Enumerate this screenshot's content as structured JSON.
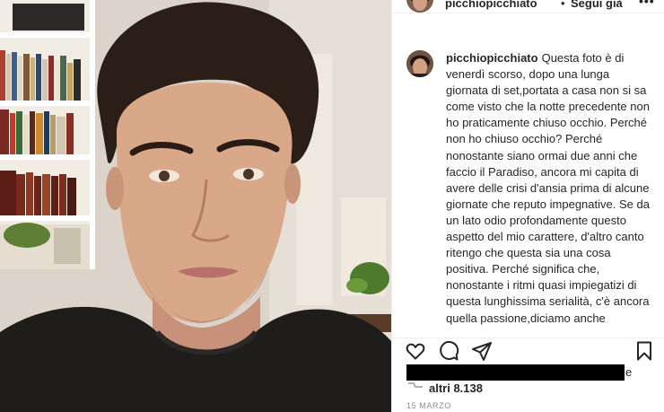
{
  "post": {
    "username": "picchiopicchiato",
    "separator": "•",
    "follow_status": "Segui già",
    "more_options": "•••",
    "caption": "Questa foto è di venerdì scorso, dopo una lunga giornata di set,portata a casa non si sa come visto che la notte precedente non ho praticamente chiuso occhio. Perché non ho chiuso occhio? Perché nonostante siano ormai due anni che faccio il Paradiso, ancora mi capita di avere delle crisi d'ansia prima di alcune giornate che reputo impegnative. Se da un lato odio profondamente questo aspetto del mio carattere, d'altro canto ritengo che questa sia una cosa positiva. Perché significa che, nonostante i ritmi quasi impiegatizi di questa lunghissima serialità, c'è ancora quella passione,diciamo anche tormento, che mi sprona a migliorarmi, a",
    "likes_tail": "e",
    "likes_others": "altri 8.138",
    "date": "15 MARZO"
  },
  "icons": {
    "like": "heart-icon",
    "comment": "comment-icon",
    "share": "paper-plane-icon",
    "save": "bookmark-icon",
    "more": "more-options-icon"
  },
  "colors": {
    "text": "#262626",
    "muted": "#8e8e8e",
    "border": "#efefef",
    "redaction": "#000000"
  }
}
